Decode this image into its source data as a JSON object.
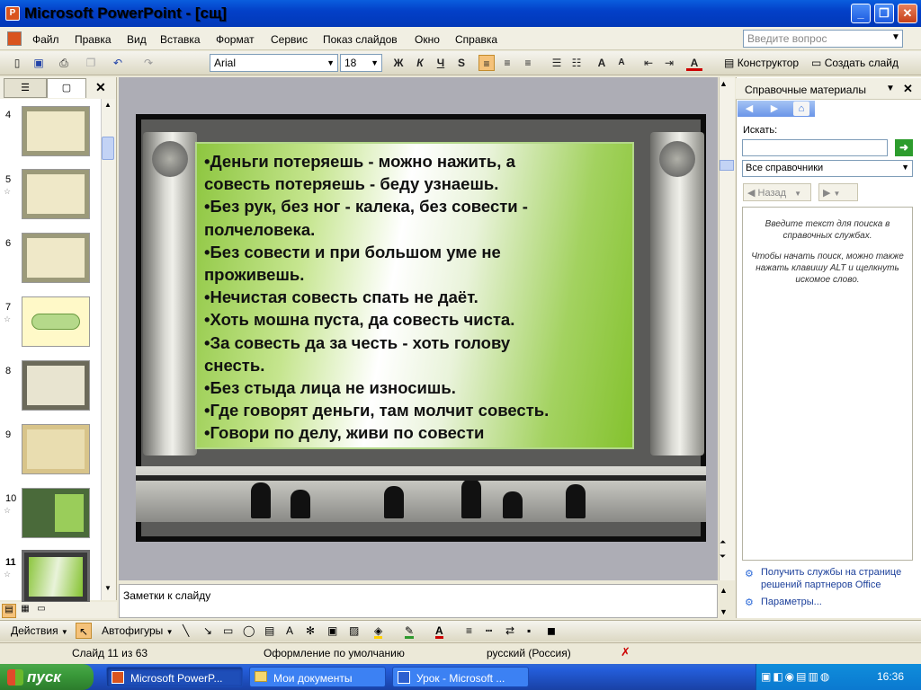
{
  "window": {
    "title": "Microsoft PowerPoint - [сщ]",
    "app_icon": "ppt-icon",
    "buttons": [
      "_",
      "❐",
      "✕"
    ]
  },
  "menu": {
    "items": [
      "Файл",
      "Правка",
      "Вид",
      "Вставка",
      "Формат",
      "Сервис",
      "Показ слайдов",
      "Окно",
      "Справка"
    ],
    "help_placeholder": "Введите вопрос"
  },
  "toolbar": {
    "font": "Arial",
    "size": "18",
    "bold": "Ж",
    "italic": "К",
    "underline": "Ч",
    "shadow": "S",
    "designer": "Конструктор",
    "new_slide": "Создать слайд"
  },
  "thumbnails": [
    {
      "num": "4",
      "style": "beige"
    },
    {
      "num": "5",
      "style": "beige"
    },
    {
      "num": "6",
      "style": "beige"
    },
    {
      "num": "7",
      "style": "yellow"
    },
    {
      "num": "8",
      "style": "beige"
    },
    {
      "num": "9",
      "style": "tan"
    },
    {
      "num": "10",
      "style": "green"
    },
    {
      "num": "11",
      "style": "green"
    }
  ],
  "slide": {
    "lines": [
      "•Деньги потеряешь - можно нажить, а",
      "совесть потеряешь - беду узнаешь.",
      "•Без рук, без ног - калека, без совести -",
      "полчеловека.",
      "•Без совести и при большом уме не",
      "проживешь.",
      "•Нечистая совесть спать не даёт.",
      "•Хоть мошна пуста, да совесть чиста.",
      "•За совесть да за честь - хоть голову",
      "снесть.",
      "•Без стыда лица не износишь.",
      "•Где говорят деньги, там молчит совесть.",
      "•Говори по делу, живи по совести"
    ]
  },
  "taskpane": {
    "title": "Справочные материалы",
    "search_label": "Искать:",
    "search_value": "",
    "reference_select": "Все справочники",
    "back_label": "Назад",
    "hint1": "Введите текст для поиска в справочных службах.",
    "hint2": "Чтобы начать поиск, можно также нажать клавишу ALT и щелкнуть искомое слово.",
    "link1": "Получить службы на странице решений партнеров Office",
    "link2": "Параметры..."
  },
  "notes": {
    "placeholder": "Заметки к слайду"
  },
  "drawbar": {
    "actions": "Действия",
    "autoshapes": "Автофигуры"
  },
  "status": {
    "slide": "Слайд 11 из 63",
    "design": "Оформление по умолчанию",
    "language": "русский (Россия)"
  },
  "taskbar": {
    "start": "пуск",
    "tasks": [
      "Microsoft PowerP...",
      "Мои документы",
      "Урок - Microsoft ..."
    ],
    "clock": "16:36"
  }
}
